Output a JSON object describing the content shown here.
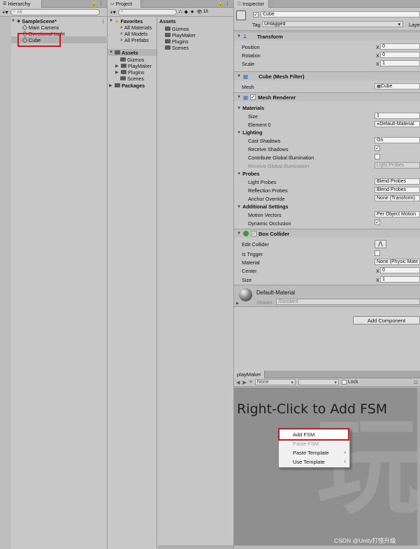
{
  "hierarchy": {
    "tab": "Hierarchy",
    "add_label": "+▾",
    "search_placeholder": "All",
    "scene": "SampleScene*",
    "items": [
      "Main Camera",
      "Directional Light",
      "Cube"
    ]
  },
  "project": {
    "tab": "Project",
    "add_label": "+▾",
    "hidden_count": "18",
    "favorites_header": "Favorites",
    "favorites": [
      "All Materials",
      "All Models",
      "All Prefabs"
    ],
    "assets_header": "Assets",
    "assets": [
      "Gizmos",
      "PlayMaker",
      "Plugins",
      "Scenes"
    ],
    "packages_header": "Packages",
    "right_title": "Assets",
    "right_items": [
      "Gizmos",
      "PlayMaker",
      "Plugins",
      "Scenes"
    ]
  },
  "inspector": {
    "tab": "Inspector",
    "object_name": "Cube",
    "tag_label": "Tag",
    "tag_value": "Untagged",
    "layer_label": "Layer",
    "transform": {
      "title": "Transform",
      "position_label": "Position",
      "rotation_label": "Rotation",
      "scale_label": "Scale",
      "axis_x": "X",
      "position_x": "0",
      "rotation_x": "0",
      "scale_x": "1"
    },
    "mesh_filter": {
      "title": "Cube (Mesh Filter)",
      "mesh_label": "Mesh",
      "mesh_value": "Cube"
    },
    "mesh_renderer": {
      "title": "Mesh Renderer",
      "materials_header": "Materials",
      "size_label": "Size",
      "size_value": "1",
      "element0_label": "Element 0",
      "element0_value": "Default-Material",
      "lighting_header": "Lighting",
      "cast_shadows_label": "Cast Shadows",
      "cast_shadows_value": "On",
      "receive_shadows_label": "Receive Shadows",
      "contribute_gi_label": "Contribute Global Illumination",
      "receive_gi_label": "Receive Global Illumination",
      "receive_gi_value": "Light Probes",
      "probes_header": "Probes",
      "light_probes_label": "Light Probes",
      "light_probes_value": "Blend Probes",
      "reflection_probes_label": "Reflection Probes",
      "reflection_probes_value": "Blend Probes",
      "anchor_override_label": "Anchor Override",
      "anchor_override_value": "None (Transform)",
      "additional_header": "Additional Settings",
      "motion_vectors_label": "Motion Vectors",
      "motion_vectors_value": "Per Object Motion",
      "dynamic_occlusion_label": "Dynamic Occlusion"
    },
    "box_collider": {
      "title": "Box Collider",
      "edit_collider_label": "Edit Collider",
      "is_trigger_label": "Is Trigger",
      "material_label": "Material",
      "material_value": "None (Physic Mate",
      "center_label": "Center",
      "center_x": "0",
      "size_label": "Size",
      "size_x": "1"
    },
    "material": {
      "name": "Default-Material",
      "shader_label": "Shader",
      "shader_value": "Standard"
    },
    "add_component": "Add Component"
  },
  "playmaker": {
    "tab": "playMaker",
    "fsm_select": "None",
    "lock_label": "Lock",
    "hint": "Right-Click to Add FSM",
    "watermark": "玩",
    "context_menu": [
      {
        "label": "Add FSM",
        "enabled": true,
        "submenu": false
      },
      {
        "label": "Paste FSM",
        "enabled": false,
        "submenu": false
      },
      {
        "label": "Paste Template",
        "enabled": true,
        "submenu": true
      },
      {
        "label": "Use Template",
        "enabled": true,
        "submenu": true
      }
    ]
  },
  "footer": {
    "credit": "CSDN @Unity打怪升级"
  },
  "colors": {
    "highlight": "#e0141e",
    "playmaker_bg": "#8f8f8f"
  }
}
